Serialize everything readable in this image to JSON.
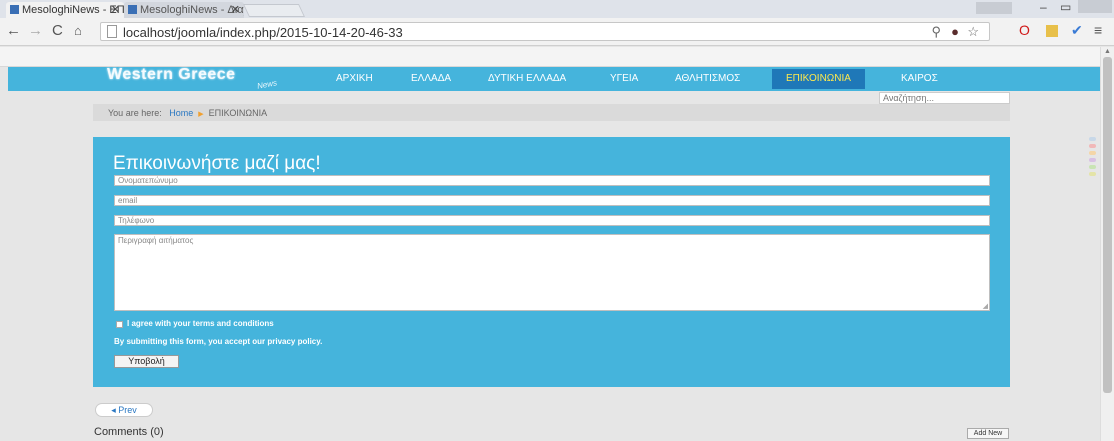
{
  "browser": {
    "tabs": [
      {
        "title": "MesologhiNews - ΕΠΙΚΟΙΝ",
        "active": true
      },
      {
        "title": "MesologhiNews - Διαχει",
        "active": false
      }
    ],
    "url": "localhost/joomla/index.php/2015-10-14-20-46-33"
  },
  "site": {
    "logo": "Western Greece",
    "logo_sub": "News",
    "menu": [
      {
        "label": "ΑΡΧΙΚΗ"
      },
      {
        "label": "ΕΛΛΑΔΑ"
      },
      {
        "label": "ΔΥΤΙΚΗ ΕΛΛΑΔΑ"
      },
      {
        "label": "ΥΓΕΙΑ"
      },
      {
        "label": "ΑΘΛΗΤΙΣΜΟΣ"
      },
      {
        "label": "ΕΠΙΚΟΙΝΩΝΙΑ",
        "active": true
      },
      {
        "label": "ΚΑΙΡΟΣ"
      }
    ],
    "search_placeholder": "Αναζήτηση..."
  },
  "breadcrumb": {
    "prefix": "You are here:",
    "home": "Home",
    "current": "ΕΠΙΚΟΙΝΩΝΙΑ"
  },
  "form": {
    "title": "Επικοινωνήστε μαζί μας!",
    "name_placeholder": "Ονοματεπώνυμο",
    "email_placeholder": "email",
    "phone_placeholder": "Τηλέφωνο",
    "message_placeholder": "Περιγραφή αιτήματος",
    "agree_label": "I agree with your terms and conditions",
    "privacy_text": "By submitting this form, you accept our privacy policy.",
    "submit_label": "Υποβολή"
  },
  "pagination": {
    "prev_label": "Prev"
  },
  "comments": {
    "title": "Comments (0)",
    "add_new_label": "Add New"
  },
  "colors": {
    "accent": "#45b4dc",
    "menu_active_bg": "#1f78b8",
    "menu_active_text": "#ffe94d"
  }
}
